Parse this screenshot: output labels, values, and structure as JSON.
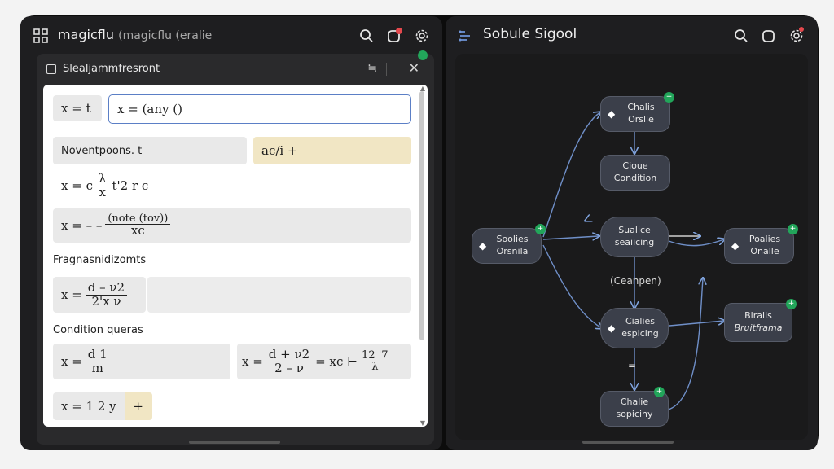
{
  "left_window": {
    "title": "magicflu",
    "subtitle": "(magicflu (eralie",
    "icons": [
      "grid-icon",
      "search-icon",
      "notification-icon",
      "settings-icon"
    ]
  },
  "sheet": {
    "title": "Slealjammfresront",
    "menu_glyph": "≒",
    "close_glyph": "✕"
  },
  "editor": {
    "row1_left": "x = t",
    "row1_input": "x = (any ()",
    "section1_label": "Noventpoons. t",
    "section1_chip": "ac/i +",
    "eq1_left": "x = c",
    "eq1_num": "λ",
    "eq1_den": "x",
    "eq1_right": "t'2 r c",
    "eq2_left": "x = – –",
    "eq2_num": "(note (tov))",
    "eq2_den": "xc",
    "section2_label": "Fragnasnidizomts",
    "eq3_left": "x =",
    "eq3_num": "d – ν2",
    "eq3_den": "2'x ν",
    "section3_label": "Condition queras",
    "eq4_left": "x =",
    "eq4_num": "d 1",
    "eq4_den": "m",
    "eq5_left": "x =",
    "eq5_num": "d + ν2",
    "eq5_den": "2 – ν",
    "eq5_mid": "= xc ⊢",
    "eq5_sup": "12 '7",
    "eq5_sub": "λ",
    "eq6": "x = 1 2 y",
    "eq6_plus": "+"
  },
  "right_window": {
    "title": "Sobule Sigool",
    "icons": [
      "flow-icon",
      "search-icon",
      "copy-icon",
      "settings-icon"
    ]
  },
  "graph": {
    "nodes": [
      {
        "id": "n1",
        "line1": "Chalis",
        "line2": "Orslle"
      },
      {
        "id": "n2",
        "line1": "Cioue",
        "line2": "Condition"
      },
      {
        "id": "n3",
        "line1": "Soolies",
        "line2": "Orsnila"
      },
      {
        "id": "n4",
        "line1": "Sualice",
        "line2": "seaiicing"
      },
      {
        "id": "n5",
        "line1": "Poalies",
        "line2": "Onalle"
      },
      {
        "id": "n6",
        "line1": "Cialies",
        "line2": "esplcing"
      },
      {
        "id": "n7",
        "line1": "Biralis",
        "line2": "Bruitframa"
      },
      {
        "id": "n8",
        "line1": "Chalie",
        "line2": "sopiciny"
      }
    ],
    "edge_label": "(Ceanpen)",
    "eq_label": "="
  }
}
